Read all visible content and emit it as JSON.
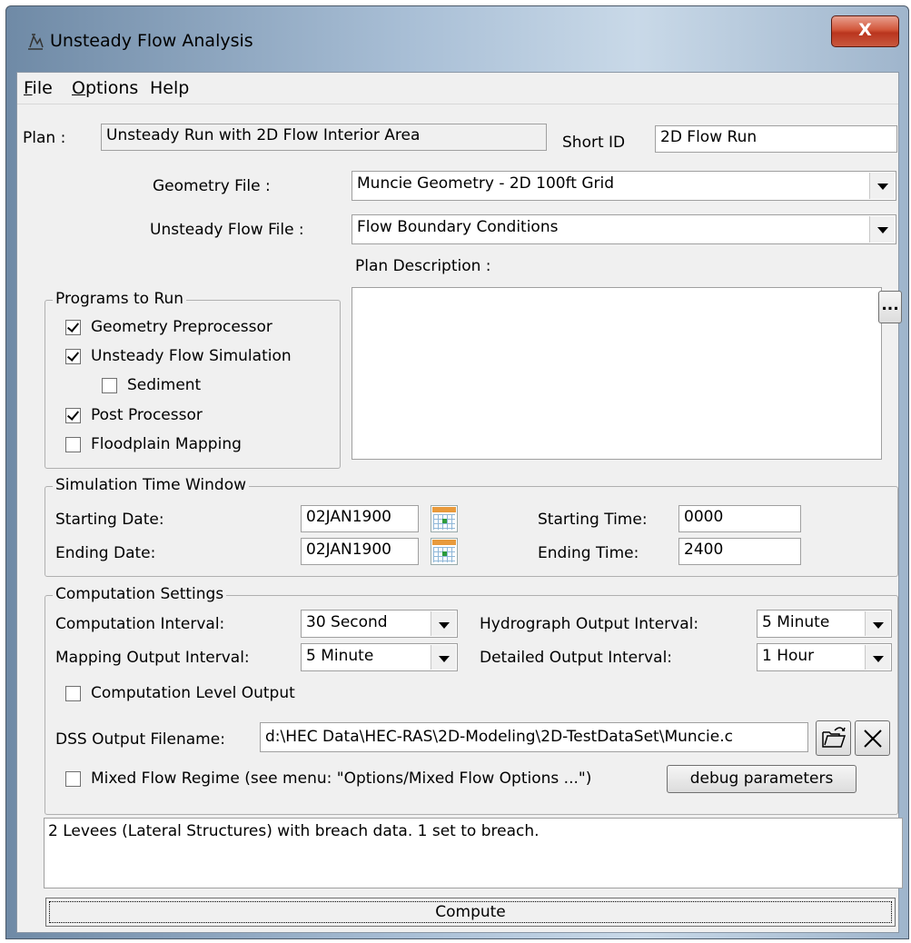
{
  "window": {
    "title": "Unsteady Flow Analysis",
    "close_label": "X"
  },
  "menu": [
    {
      "mnemonic": "F",
      "rest": "ile"
    },
    {
      "mnemonic": "O",
      "rest": "ptions"
    },
    {
      "mnemonic": "",
      "rest": "Help"
    }
  ],
  "plan": {
    "label": "Plan :",
    "value": "Unsteady Run with 2D Flow Interior Area",
    "short_id_label": "Short ID",
    "short_id_value": "2D Flow Run"
  },
  "geometry": {
    "label": "Geometry File :",
    "value": "Muncie Geometry - 2D 100ft Grid"
  },
  "unsteady": {
    "label": "Unsteady Flow File :",
    "value": "Flow Boundary Conditions"
  },
  "plan_description": {
    "label": "Plan Description :",
    "value": "",
    "ellipsis_label": "..."
  },
  "programs": {
    "legend": "Programs to Run",
    "items": [
      {
        "label": "Geometry Preprocessor",
        "checked": true
      },
      {
        "label": "Unsteady Flow Simulation",
        "checked": true
      },
      {
        "label": "Sediment",
        "checked": false
      },
      {
        "label": "Post Processor",
        "checked": true
      },
      {
        "label": "Floodplain Mapping",
        "checked": false
      }
    ]
  },
  "sim_window": {
    "legend": "Simulation Time Window",
    "start_date_label": "Starting Date:",
    "start_date": "02JAN1900",
    "end_date_label": "Ending Date:",
    "end_date": "02JAN1900",
    "start_time_label": "Starting Time:",
    "start_time": "0000",
    "end_time_label": "Ending Time:",
    "end_time": "2400"
  },
  "computation": {
    "legend": "Computation Settings",
    "comp_interval_label": "Computation Interval:",
    "comp_interval": "30 Second",
    "hydro_label": "Hydrograph Output Interval:",
    "hydro": "5 Minute",
    "mapping_label": "Mapping Output Interval:",
    "mapping": "5 Minute",
    "detailed_label": "Detailed Output Interval:",
    "detailed": "1 Hour",
    "level_output_label": "Computation Level Output",
    "level_output_checked": false,
    "dss_label": "DSS Output Filename:",
    "dss_value": "d:\\HEC Data\\HEC-RAS\\2D-Modeling\\2D-TestDataSet\\Muncie.c",
    "mixed_label": "Mixed Flow Regime (see menu: \"Options/Mixed Flow Options ...\")",
    "mixed_checked": false,
    "debug_label": "debug parameters"
  },
  "status_text": "2 Levees (Lateral Structures) with breach data. 1 set to breach.",
  "compute_label": "Compute",
  "colors": {
    "window_gradient": "#a9bfd6",
    "close_red": "#c9452b",
    "dialog_bg": "#f0f0f0"
  }
}
